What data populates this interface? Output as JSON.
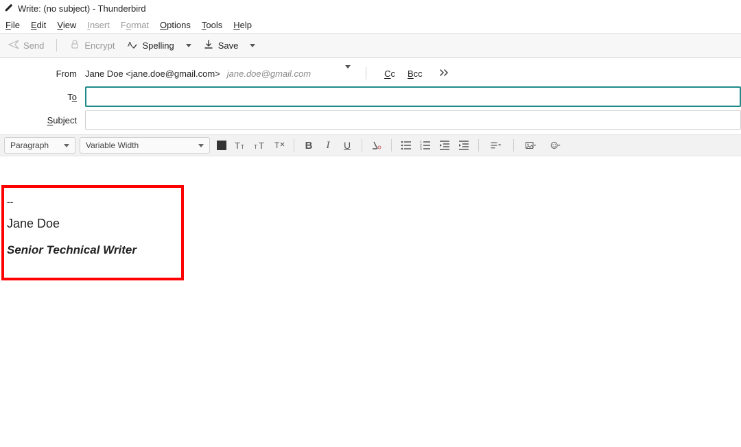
{
  "window": {
    "title": "Write: (no subject) - Thunderbird"
  },
  "menu": {
    "file": {
      "label": "File",
      "hotkey": "F"
    },
    "edit": {
      "label": "Edit",
      "hotkey": "E"
    },
    "view": {
      "label": "View",
      "hotkey": "V"
    },
    "insert": {
      "label": "Insert",
      "hotkey": "I"
    },
    "format": {
      "label": "Format",
      "hotkey": "o"
    },
    "options": {
      "label": "Options",
      "hotkey": "O"
    },
    "tools": {
      "label": "Tools",
      "hotkey": "T"
    },
    "help": {
      "label": "Help",
      "hotkey": "H"
    }
  },
  "toolbar": {
    "send": "Send",
    "encrypt": "Encrypt",
    "spelling": "Spelling",
    "save": "Save"
  },
  "header": {
    "from_label": "From",
    "from_value": "Jane Doe <jane.doe@gmail.com>",
    "identity": "jane.doe@gmail.com",
    "cc": "Cc",
    "bcc": "Bcc",
    "to_label": "To",
    "to_value": "",
    "subject_label": "Subject",
    "subject_value": ""
  },
  "format_bar": {
    "block_style": "Paragraph",
    "font_family": "Variable Width"
  },
  "signature": {
    "dashes": "--",
    "name": "Jane Doe",
    "title": "Senior Technical Writer"
  }
}
